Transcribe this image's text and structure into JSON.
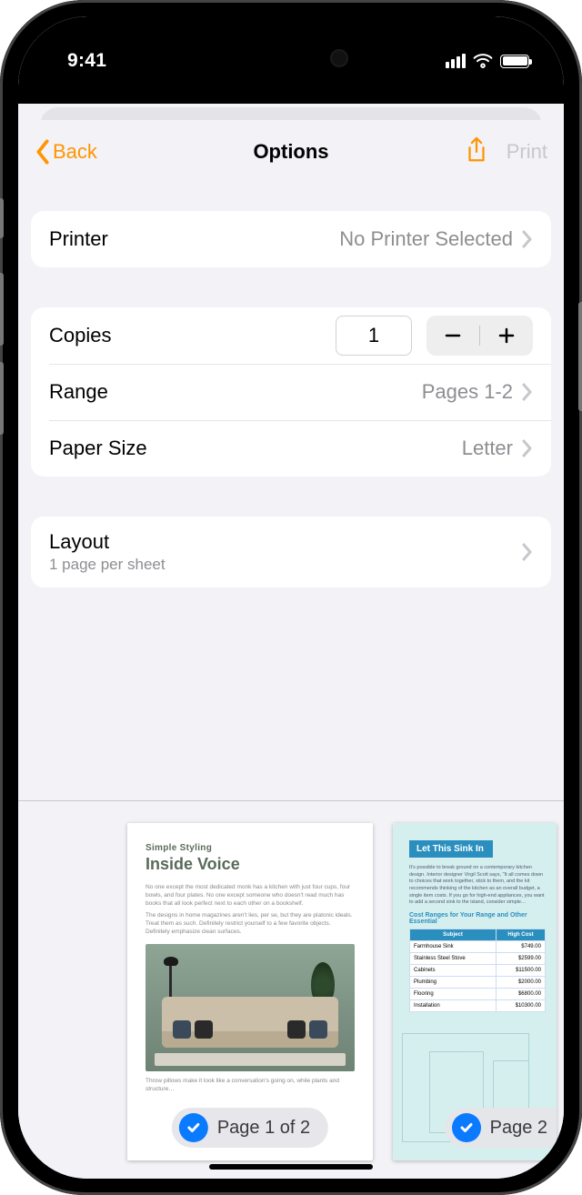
{
  "status": {
    "time": "9:41"
  },
  "nav": {
    "back_label": "Back",
    "title": "Options",
    "print_label": "Print"
  },
  "printer": {
    "label": "Printer",
    "value": "No Printer Selected"
  },
  "copies": {
    "label": "Copies",
    "value": "1"
  },
  "range": {
    "label": "Range",
    "value": "Pages 1-2"
  },
  "paper": {
    "label": "Paper Size",
    "value": "Letter"
  },
  "layout": {
    "label": "Layout",
    "sub": "1 page per sheet"
  },
  "preview": {
    "page1": {
      "pill": "Page 1 of 2",
      "eyebrow": "Simple Styling",
      "title": "Inside Voice"
    },
    "page2": {
      "pill": "Page 2",
      "badge": "Let This Sink In",
      "cost_title": "Cost Ranges for Your Range and Other Essential",
      "table": {
        "headers": [
          "Subject",
          "High Cost"
        ],
        "rows": [
          [
            "Farmhouse Sink",
            "$749.00"
          ],
          [
            "Stainless Steel Stove",
            "$2599.00"
          ],
          [
            "Cabinets",
            "$11500.00"
          ],
          [
            "Plumbing",
            "$2000.00"
          ],
          [
            "Flooring",
            "$6800.00"
          ],
          [
            "Installation",
            "$10300.00"
          ]
        ]
      }
    }
  }
}
